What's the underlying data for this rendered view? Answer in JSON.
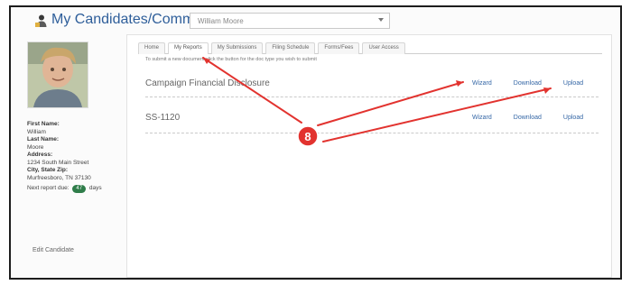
{
  "app": {
    "title": "My Candidates/Committees",
    "selector_value": "William Moore"
  },
  "candidate": {
    "first_name_label": "First Name:",
    "first_name": "William",
    "last_name_label": "Last Name:",
    "last_name": "Moore",
    "address_label": "Address:",
    "address_line": "1234 South Main Street",
    "city_zip_label": "City, State Zip:",
    "city_zip_value": "Murfreesboro, TN 37130",
    "next_report_label": "Next report due:",
    "next_report_days": "47",
    "next_report_suffix": "days",
    "edit_label": "Edit Candidate"
  },
  "tabs": [
    "Home",
    "My Reports",
    "My Submissions",
    "Filing Schedule",
    "Forms/Fees",
    "User Access"
  ],
  "reports": {
    "instruction": "To submit a new document click the button for the doc type you wish to submit",
    "rows": [
      {
        "title": "Campaign Financial Disclosure",
        "links": [
          "Wizard",
          "Download",
          "Upload"
        ]
      },
      {
        "title": "SS-1120",
        "links": [
          "Wizard",
          "Download",
          "Upload"
        ]
      }
    ]
  },
  "annotation": {
    "number": "8",
    "color": "#e2332f"
  }
}
